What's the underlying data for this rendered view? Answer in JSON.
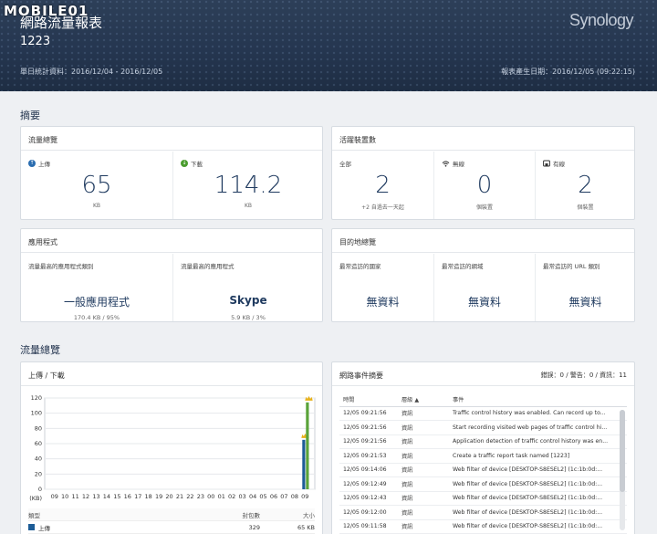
{
  "watermark": "MOBILE01",
  "header": {
    "title": "網路流量報表",
    "subtitle": "1223",
    "period": "單日統計資料：2016/12/04 - 2016/12/05",
    "created": "報表產生日期：2016/12/05 (09:22:15)",
    "brand": "Synology"
  },
  "summary": {
    "section_title": "摘要",
    "traffic": {
      "title": "流量總覽",
      "upload_label": "上傳",
      "upload_value": "65",
      "upload_unit": "KB",
      "download_label": "下載",
      "download_value": "114.2",
      "download_unit": "KB"
    },
    "devices": {
      "title": "活躍裝置數",
      "all_label": "全部",
      "all_value": "2",
      "all_note": "+2 自過去一天起",
      "wireless_label": "無線",
      "wireless_value": "0",
      "wireless_unit": "個裝置",
      "wired_label": "有線",
      "wired_value": "2",
      "wired_unit": "個裝置"
    },
    "apps": {
      "title": "應用程式",
      "cat_label": "流量最高的應用程式類別",
      "cat_value": "一般應用程式",
      "cat_note": "170.4 KB / 95%",
      "app_label": "流量最高的應用程式",
      "app_value": "Skype",
      "app_note": "5.9 KB / 3%"
    },
    "destinations": {
      "title": "目的地總覽",
      "country_label": "最常造訪的國家",
      "country_value": "無資料",
      "site_label": "最常造訪的網域",
      "site_value": "無資料",
      "url_label": "最常造訪的 URL 類別",
      "url_value": "無資料"
    }
  },
  "traffic_section": {
    "section_title": "流量總覽",
    "chart_title": "上傳 / 下載",
    "legend_headers": [
      "類型",
      "封包數",
      "大小"
    ],
    "legend_rows": [
      {
        "label": "上傳",
        "packets": "329",
        "size": "65 KB"
      }
    ]
  },
  "chart_data": {
    "type": "bar",
    "title": "上傳 / 下載",
    "ylabel": "(KB)",
    "ylim": [
      0,
      120
    ],
    "yticks": [
      0,
      20,
      40,
      60,
      80,
      100,
      120
    ],
    "categories": [
      "09",
      "10",
      "11",
      "12",
      "13",
      "14",
      "15",
      "16",
      "17",
      "18",
      "19",
      "20",
      "21",
      "22",
      "23",
      "00",
      "01",
      "02",
      "03",
      "04",
      "05",
      "06",
      "07",
      "08",
      "09"
    ],
    "series": [
      {
        "name": "上傳",
        "color": "#1d5c96",
        "values": [
          0,
          0,
          0,
          0,
          0,
          0,
          0,
          0,
          0,
          0,
          0,
          0,
          0,
          0,
          0,
          0,
          0,
          0,
          0,
          0,
          0,
          0,
          0,
          0,
          65
        ]
      },
      {
        "name": "下載",
        "color": "#5aa33a",
        "values": [
          0,
          0,
          0,
          0,
          0,
          0,
          0,
          0,
          0,
          0,
          0,
          0,
          0,
          0,
          0,
          0,
          0,
          0,
          0,
          0,
          0,
          0,
          0,
          0,
          114.2
        ]
      }
    ]
  },
  "events": {
    "title": "網路事件摘要",
    "counts": "錯誤：0 / 警告：0 / 資訊：11",
    "headers": [
      "時間",
      "層級 ▲",
      "事件"
    ],
    "rows": [
      {
        "time": "12/05 09:21:56",
        "level": "資訊",
        "event": "Traffic control history was enabled. Can record up to..."
      },
      {
        "time": "12/05 09:21:56",
        "level": "資訊",
        "event": "Start recording visited web pages of traffic control hi..."
      },
      {
        "time": "12/05 09:21:56",
        "level": "資訊",
        "event": "Application detection of traffic control history was en..."
      },
      {
        "time": "12/05 09:21:53",
        "level": "資訊",
        "event": "Create a traffic report task named [1223]"
      },
      {
        "time": "12/05 09:14:06",
        "level": "資訊",
        "event": "Web filter of device [DESKTOP-S8ESEL2] (1c:1b:0d:..."
      },
      {
        "time": "12/05 09:12:49",
        "level": "資訊",
        "event": "Web filter of device [DESKTOP-S8ESEL2] (1c:1b:0d:..."
      },
      {
        "time": "12/05 09:12:43",
        "level": "資訊",
        "event": "Web filter of device [DESKTOP-S8ESEL2] (1c:1b:0d:..."
      },
      {
        "time": "12/05 09:12:00",
        "level": "資訊",
        "event": "Web filter of device [DESKTOP-S8ESEL2] (1c:1b:0d:..."
      },
      {
        "time": "12/05 09:11:58",
        "level": "資訊",
        "event": "Web filter of device [DESKTOP-S8ESEL2] (1c:1b:0d:..."
      }
    ]
  }
}
